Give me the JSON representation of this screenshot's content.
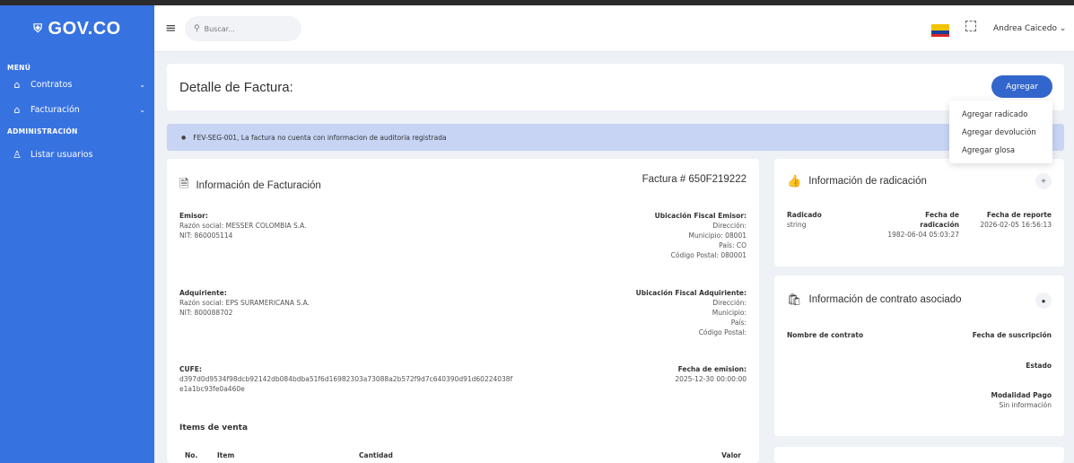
{
  "sidebar": {
    "logo": "GOV.CO",
    "sections": {
      "menu": "MENÚ",
      "admin": "ADMINISTRACIÓN"
    },
    "items": [
      {
        "label": "Contratos",
        "icon": "home-icon"
      },
      {
        "label": "Facturación",
        "icon": "home-icon"
      },
      {
        "label": "Listar usuarios",
        "icon": "user-icon"
      }
    ]
  },
  "topbar": {
    "search_placeholder": "Buscar...",
    "user": "Andrea Caicedo"
  },
  "header": {
    "title": "Detalle de Factura:",
    "add_button": "Agregar",
    "add_menu": [
      "Agregar radicado",
      "Agregar devolución",
      "Agregar glosa"
    ]
  },
  "alert": "FEV-SEG-001, La factura no cuenta con informacion de auditoria registrada",
  "facturacion": {
    "title": "Información de Facturación",
    "invoice_number": "Factura # 650F219222",
    "emisor": {
      "heading": "Emisor:",
      "razon": "Razón social: MESSER COLOMBIA S.A.",
      "nit": "NIT: 860005114"
    },
    "ubicacion_emisor": {
      "heading": "Ubicación Fiscal Emisor:",
      "direccion": "Dirección:",
      "municipio": "Municipio: 08001",
      "pais": "País: CO",
      "postal": "Código Postal: 080001"
    },
    "adquiriente": {
      "heading": "Adquiriente:",
      "razon": "Razón social: EPS SURAMERICANA S.A.",
      "nit": "NIT: 800088702"
    },
    "ubicacion_adquiriente": {
      "heading": "Ubicación Fiscal Adquiriente:",
      "direccion": "Dirección:",
      "municipio": "Municipio:",
      "pais": "País:",
      "postal": "Código Postal:"
    },
    "cufe": {
      "heading": "CUFE:",
      "line1": "d397d0d9534f98dcb92142db084bdba51f6d16982303a73088a2b572f9d7c640390d91d60224038f",
      "line2": "e1a1bc93fe0a460e"
    },
    "fecha_emision": {
      "heading": "Fecha de emision:",
      "value": "2025-12-30 00:00:00"
    },
    "items_title": "Items de venta",
    "items_columns": [
      "No.",
      "Item",
      "Cantidad",
      "Valor"
    ]
  },
  "radicacion": {
    "title": "Información de radicación",
    "radicado_label": "Radicado",
    "radicado_value": "string",
    "fecha_label_1": "Fecha de",
    "fecha_label_2": "radicación",
    "fecha_value": "1982-06-04 05:03:27",
    "reporte_label": "Fecha de reporte",
    "reporte_value": "2026-02-05 16:56:13"
  },
  "contrato": {
    "title": "Información de contrato asociado",
    "nombre_label": "Nombre de contrato",
    "suscripcion_label": "Fecha de suscripción",
    "estado_label": "Estado",
    "modalidad_label": "Modalidad Pago",
    "modalidad_value": "Sin información"
  },
  "colors": {
    "sidebar": "#3772e1",
    "primary_button": "#3366cc",
    "alert_bg": "#c7d4f4",
    "background": "#eef1f6"
  }
}
